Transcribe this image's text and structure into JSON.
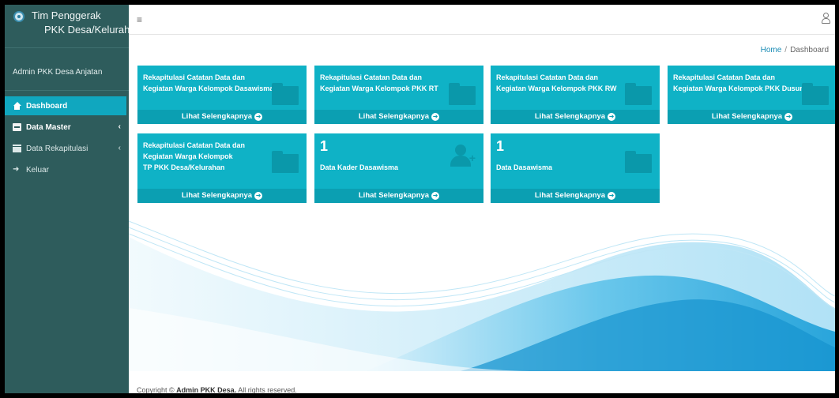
{
  "sidebar": {
    "brand_line1": "Tim Penggerak",
    "brand_line2": "PKK Desa/Kelurahan",
    "user_name": "Admin PKK Desa Anjatan",
    "items": [
      {
        "label": "Dashboard",
        "icon": "home-icon",
        "active": true
      },
      {
        "label": "Data Master",
        "icon": "box-icon",
        "caret": "‹"
      },
      {
        "label": "Data Rekapitulasi",
        "icon": "archive-icon",
        "caret": "‹"
      },
      {
        "label": "Keluar",
        "icon": "sign-out-icon"
      }
    ]
  },
  "topbar": {
    "menu_icon": "≡",
    "user_icon": "user-icon"
  },
  "breadcrumb": {
    "home": "Home",
    "separator": "/",
    "current": "Dashboard"
  },
  "cards": [
    {
      "title_1": "Rekapitulasi Catatan Data dan",
      "title_2": "Kegiatan Warga Kelompok Dasawisma",
      "link": "Lihat Selengkapnya",
      "icon": "folder-icon"
    },
    {
      "title_1": "Rekapitulasi Catatan Data dan",
      "title_2": "Kegiatan Warga Kelompok PKK RT",
      "link": "Lihat Selengkapnya",
      "icon": "folder-icon"
    },
    {
      "title_1": "Rekapitulasi Catatan Data dan",
      "title_2": "Kegiatan Warga Kelompok PKK RW",
      "link": "Lihat Selengkapnya",
      "icon": "folder-icon"
    },
    {
      "title_1": "Rekapitulasi Catatan Data dan",
      "title_2": "Kegiatan Warga Kelompok PKK Dusun",
      "link": "Lihat Selengkapnya",
      "icon": "folder-icon"
    },
    {
      "title_1": "Rekapitulasi Catatan Data dan",
      "title_2": "Kegiatan Warga Kelompok",
      "title_3": "TP PKK Desa/Kelurahan",
      "link": "Lihat Selengkapnya",
      "icon": "folder-icon"
    },
    {
      "count": "1",
      "title": "Data Kader Dasawisma",
      "link": "Lihat Selengkapnya",
      "icon": "user-plus-icon"
    },
    {
      "count": "1",
      "title": "Data Dasawisma",
      "link": "Lihat Selengkapnya",
      "icon": "folder-icon"
    }
  ],
  "footer": {
    "prefix": "Copyright ©",
    "owner": "Admin PKK Desa.",
    "suffix": "All rights reserved."
  },
  "colors": {
    "sidebar": "#2e5c5c",
    "accent": "#10a7bf",
    "card": "#0fb2c6",
    "card_footer": "#0b9fb2"
  }
}
